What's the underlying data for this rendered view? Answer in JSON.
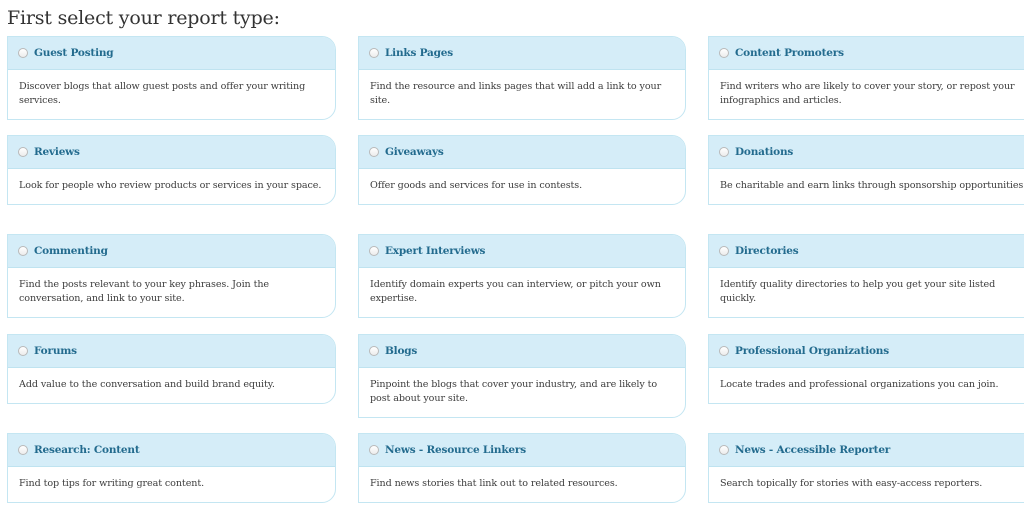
{
  "page": {
    "title": "First select your report type:"
  },
  "colors": {
    "header_bg": "#d5edf8",
    "border": "#c4e6f2",
    "title_text": "#236b8e",
    "desc_text": "#3d3d3d"
  },
  "report_types": [
    {
      "label": "Guest Posting",
      "description": "Discover blogs that allow guest posts and offer your writing services.",
      "selected": false
    },
    {
      "label": "Links Pages",
      "description": "Find the resource and links pages that will add a link to your site.",
      "selected": false
    },
    {
      "label": "Content Promoters",
      "description": "Find writers who are likely to cover your story, or repost your infographics and articles.",
      "selected": false
    },
    {
      "label": "Reviews",
      "description": "Look for people who review products or services in your space.",
      "selected": false
    },
    {
      "label": "Giveaways",
      "description": "Offer goods and services for use in contests.",
      "selected": false
    },
    {
      "label": "Donations",
      "description": "Be charitable and earn links through sponsorship opportunities.",
      "selected": false
    },
    {
      "label": "Commenting",
      "description": "Find the posts relevant to your key phrases. Join the conversation, and link to your site.",
      "selected": false
    },
    {
      "label": "Expert Interviews",
      "description": "Identify domain experts you can interview, or pitch your own expertise.",
      "selected": false
    },
    {
      "label": "Directories",
      "description": "Identify quality directories to help you get your site listed quickly.",
      "selected": false
    },
    {
      "label": "Forums",
      "description": "Add value to the conversation and build brand equity.",
      "selected": false
    },
    {
      "label": "Blogs",
      "description": "Pinpoint the blogs that cover your industry, and are likely to post about your site.",
      "selected": false
    },
    {
      "label": "Professional Organizations",
      "description": "Locate trades and professional organizations you can join.",
      "selected": false
    },
    {
      "label": "Research: Content",
      "description": "Find top tips for writing great content.",
      "selected": false
    },
    {
      "label": "News - Resource Linkers",
      "description": "Find news stories that link out to related resources.",
      "selected": false
    },
    {
      "label": "News - Accessible Reporter",
      "description": "Search topically for stories with easy-access reporters.",
      "selected": false
    }
  ]
}
